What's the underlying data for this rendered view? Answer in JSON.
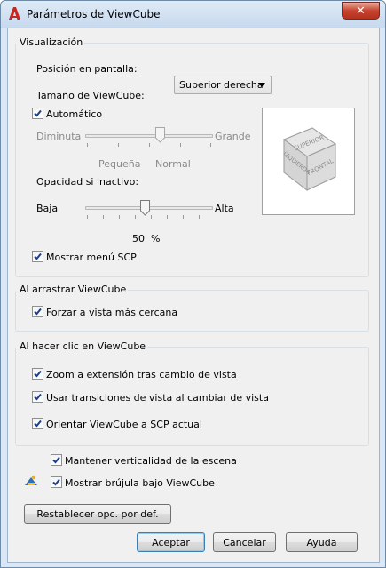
{
  "window": {
    "title": "Parámetros de ViewCube",
    "close_glyph": "✕"
  },
  "visualizacion": {
    "group_title": "Visualización",
    "position_label": "Posición en pantalla:",
    "position_value": "Superior derecha",
    "size_label": "Tamaño de ViewCube:",
    "auto_label": "Automático",
    "auto_checked": true,
    "size_min_label": "Diminuta",
    "size_max_label": "Grande",
    "size_tick_small": "Pequeña",
    "size_tick_normal": "Normal",
    "opacity_label": "Opacidad si inactivo:",
    "opacity_min_label": "Baja",
    "opacity_max_label": "Alta",
    "opacity_value": "50",
    "opacity_unit": "%",
    "show_ucs_menu_label": "Mostrar menú SCP",
    "show_ucs_menu_checked": true,
    "cube_faces": {
      "top": "SUPERIOR",
      "left": "IZQUIERDA",
      "right": "FRONTAL"
    }
  },
  "arrastrar": {
    "group_title": "Al arrastrar ViewCube",
    "snap_label": "Forzar a vista más cercana",
    "snap_checked": true
  },
  "clic": {
    "group_title": "Al hacer clic en ViewCube",
    "zoom_label": "Zoom a extensión tras cambio de vista",
    "transitions_label": "Usar transiciones de vista al cambiar de vista",
    "orient_label": "Orientar ViewCube a SCP actual"
  },
  "misc": {
    "keep_up_label": "Mantener verticalidad de la escena",
    "compass_label": "Mostrar brújula bajo ViewCube"
  },
  "buttons": {
    "restore": "Restablecer opc. por def.",
    "ok": "Aceptar",
    "cancel": "Cancelar",
    "help": "Ayuda"
  },
  "colors": {
    "accent_red": "#c7432f",
    "default_button": "#3c7fb1"
  }
}
